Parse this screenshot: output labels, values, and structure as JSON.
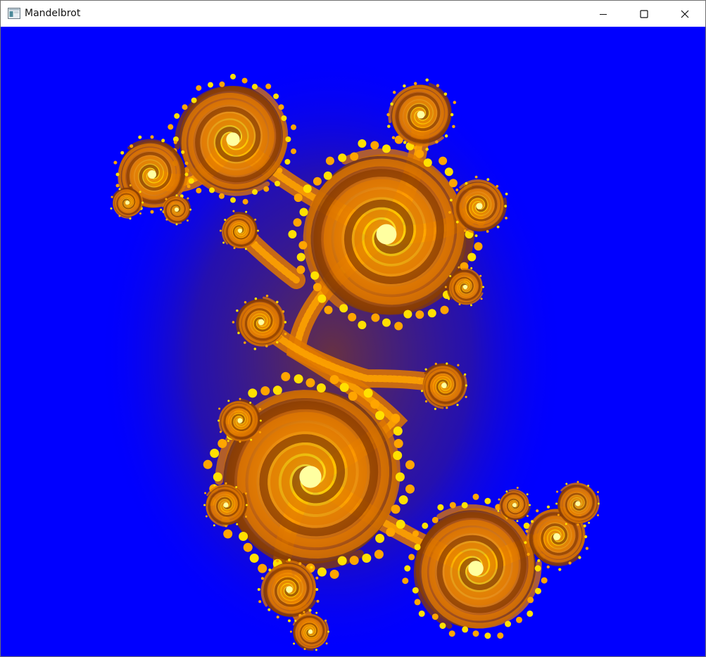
{
  "window": {
    "title": "Mandelbrot",
    "icon": "app-window-icon",
    "controls": {
      "minimize": "minimize-icon",
      "maximize": "maximize-icon",
      "close": "close-icon"
    }
  },
  "canvas": {
    "background_color": "#0000ff",
    "fractal_colors": [
      "#ffe000",
      "#ffa500",
      "#e07800",
      "#8a3c00",
      "#5a2a30"
    ],
    "content": "julia-set-fractal"
  }
}
